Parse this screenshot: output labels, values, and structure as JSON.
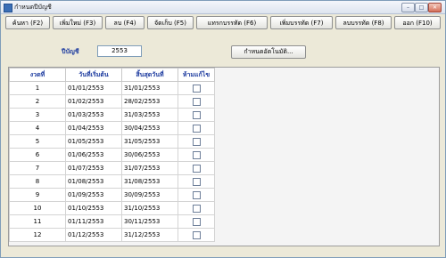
{
  "window": {
    "title": "กำหนดปีบัญชี"
  },
  "toolbar": {
    "buttons": [
      {
        "label": "ค้นหา (F2)"
      },
      {
        "label": "เพิ่มใหม่ (F3)"
      },
      {
        "label": "ลบ (F4)"
      },
      {
        "label": "จัดเก็บ (F5)"
      },
      {
        "label": "แทรกบรรทัด (F6)"
      },
      {
        "label": "เพิ่มบรรทัด (F7)"
      },
      {
        "label": "ลบบรรทัด (F8)"
      },
      {
        "label": "ออก (F10)"
      }
    ]
  },
  "form": {
    "year_label": "ปีบัญชี",
    "year_value": "2553",
    "setup_button": "กำหนดอัตโนมัติ..."
  },
  "table": {
    "headers": [
      "งวดที่",
      "วันที่เริ่มต้น",
      "สิ้นสุดวันที่",
      "ห้ามแก้ไข"
    ],
    "rows": [
      {
        "period": "1",
        "start": "01/01/2553",
        "end": "31/01/2553"
      },
      {
        "period": "2",
        "start": "01/02/2553",
        "end": "28/02/2553"
      },
      {
        "period": "3",
        "start": "01/03/2553",
        "end": "31/03/2553"
      },
      {
        "period": "4",
        "start": "01/04/2553",
        "end": "30/04/2553"
      },
      {
        "period": "5",
        "start": "01/05/2553",
        "end": "31/05/2553"
      },
      {
        "period": "6",
        "start": "01/06/2553",
        "end": "30/06/2553"
      },
      {
        "period": "7",
        "start": "01/07/2553",
        "end": "31/07/2553"
      },
      {
        "period": "8",
        "start": "01/08/2553",
        "end": "31/08/2553"
      },
      {
        "period": "9",
        "start": "01/09/2553",
        "end": "30/09/2553"
      },
      {
        "period": "10",
        "start": "01/10/2553",
        "end": "31/10/2553"
      },
      {
        "period": "11",
        "start": "01/11/2553",
        "end": "30/11/2553"
      },
      {
        "period": "12",
        "start": "01/12/2553",
        "end": "31/12/2553"
      }
    ]
  }
}
